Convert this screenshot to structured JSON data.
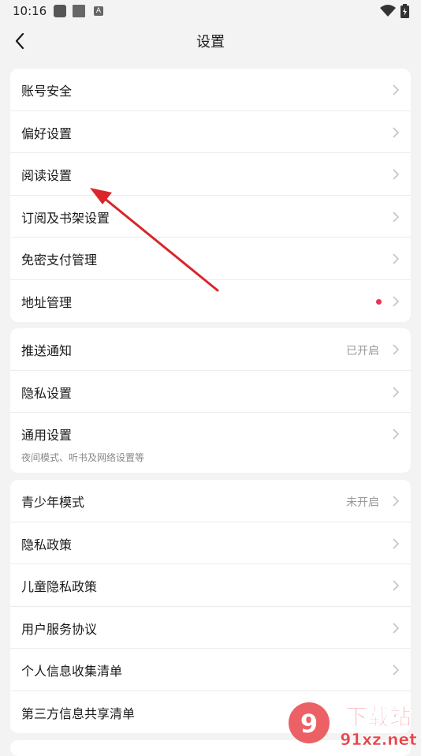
{
  "status_bar": {
    "time": "10:16",
    "badge_glyph": "A"
  },
  "nav": {
    "title": "设置"
  },
  "groups": [
    {
      "items": [
        {
          "label": "账号安全"
        },
        {
          "label": "偏好设置"
        },
        {
          "label": "阅读设置"
        },
        {
          "label": "订阅及书架设置"
        },
        {
          "label": "免密支付管理"
        },
        {
          "label": "地址管理",
          "badge_dot": true
        }
      ]
    },
    {
      "items": [
        {
          "label": "推送通知",
          "value": "已开启"
        },
        {
          "label": "隐私设置"
        },
        {
          "label": "通用设置",
          "subtitle": "夜间模式、听书及网络设置等"
        }
      ]
    },
    {
      "items": [
        {
          "label": "青少年模式",
          "value": "未开启"
        },
        {
          "label": "隐私政策"
        },
        {
          "label": "儿童隐私政策"
        },
        {
          "label": "用户服务协议"
        },
        {
          "label": "个人信息收集清单"
        },
        {
          "label": "第三方信息共享清单"
        }
      ]
    }
  ],
  "watermark": {
    "text": "下载站",
    "url": "91xz.net"
  },
  "colors": {
    "accent_dot": "#ee3355",
    "annotation_arrow": "#d9262b",
    "background": "#f3f3f3"
  }
}
